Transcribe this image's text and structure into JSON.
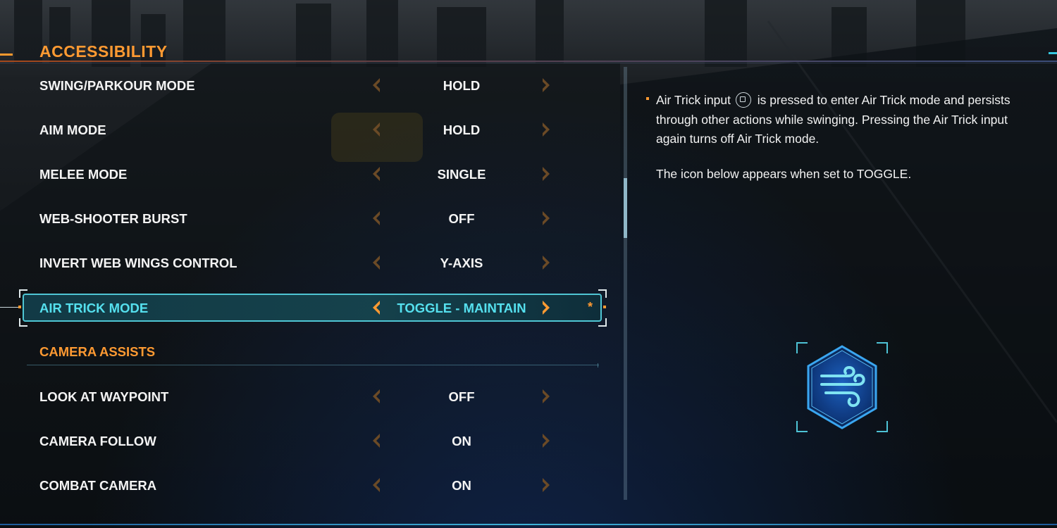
{
  "page": {
    "title": "ACCESSIBILITY"
  },
  "settings": [
    {
      "label": "SWING/PARKOUR MODE",
      "value": "HOLD"
    },
    {
      "label": "AIM MODE",
      "value": "HOLD"
    },
    {
      "label": "MELEE MODE",
      "value": "SINGLE"
    },
    {
      "label": "WEB-SHOOTER BURST",
      "value": "OFF"
    },
    {
      "label": "INVERT WEB WINGS CONTROL",
      "value": "Y-AXIS"
    },
    {
      "label": "AIR TRICK MODE",
      "value": "TOGGLE - MAINTAIN",
      "selected": true,
      "modified_marker": "*"
    }
  ],
  "camera_section": {
    "title": "CAMERA ASSISTS",
    "settings": [
      {
        "label": "LOOK AT WAYPOINT",
        "value": "OFF"
      },
      {
        "label": "CAMERA FOLLOW",
        "value": "ON"
      },
      {
        "label": "COMBAT CAMERA",
        "value": "ON"
      }
    ]
  },
  "description": {
    "text_before_glyph": "Air Trick input",
    "glyph": "square-button-icon",
    "text_after_glyph": "is pressed to enter Air Trick mode and persists through other actions while swinging. Pressing the Air Trick input again turns off Air Trick mode.",
    "note": "The icon below appears when set to TOGGLE.",
    "preview_icon": "air-trick-wind-icon"
  },
  "scroll": {
    "position_fraction": 0.26
  },
  "colors": {
    "accent_orange": "#ff9a32",
    "selected_cyan": "#55e0ee",
    "icon_blue": "#1f6fd0"
  }
}
